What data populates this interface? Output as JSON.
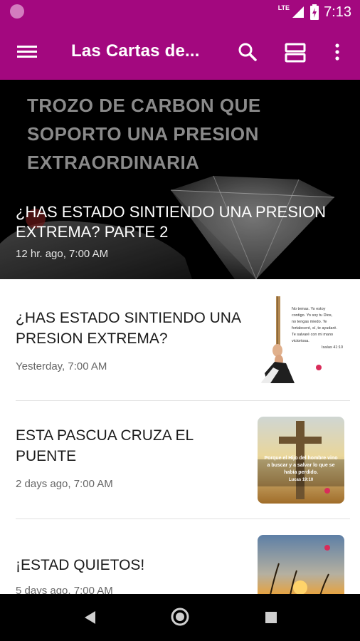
{
  "status_bar": {
    "time": "7:13",
    "network": "LTE"
  },
  "app_bar": {
    "title": "Las Cartas de..."
  },
  "hero": {
    "image_text": [
      "TROZO DE CARBON QUE",
      "SOPORTO UNA PRESION",
      "EXTRAORDINARIA"
    ],
    "title": "¿HAS ESTADO SINTIENDO UNA PRESION EXTREMA? PARTE 2",
    "meta": "12 hr. ago, 7:00 AM"
  },
  "articles": [
    {
      "title": "¿HAS ESTADO SINTIENDO UNA PRESION EXTREMA?",
      "meta": "Yesterday, 7:00 AM",
      "thumb_text": [
        "No temas. Yo estoy",
        "contigo. Yo soy tu Dios,",
        "no tengas miedo. Te",
        "fortaleceré, sí, te ayudaré.",
        "Te salvaré con mi mano",
        "victoriosa.",
        "Isaías 41:10"
      ]
    },
    {
      "title": "ESTA PASCUA CRUZA EL PUENTE",
      "meta": "2 days ago, 7:00 AM",
      "thumb_text": [
        "Porque el Hijo del hombre vino",
        "a buscar y a salvar lo que se",
        "había perdido.",
        "Lucas 19:10"
      ]
    },
    {
      "title": "¡ESTAD QUIETOS!",
      "meta": "5 days ago, 7:00 AM",
      "thumb_text": []
    }
  ],
  "colors": {
    "primary": "#a3087f",
    "hero_bg": "#000000",
    "nav_bar": "#000000"
  }
}
